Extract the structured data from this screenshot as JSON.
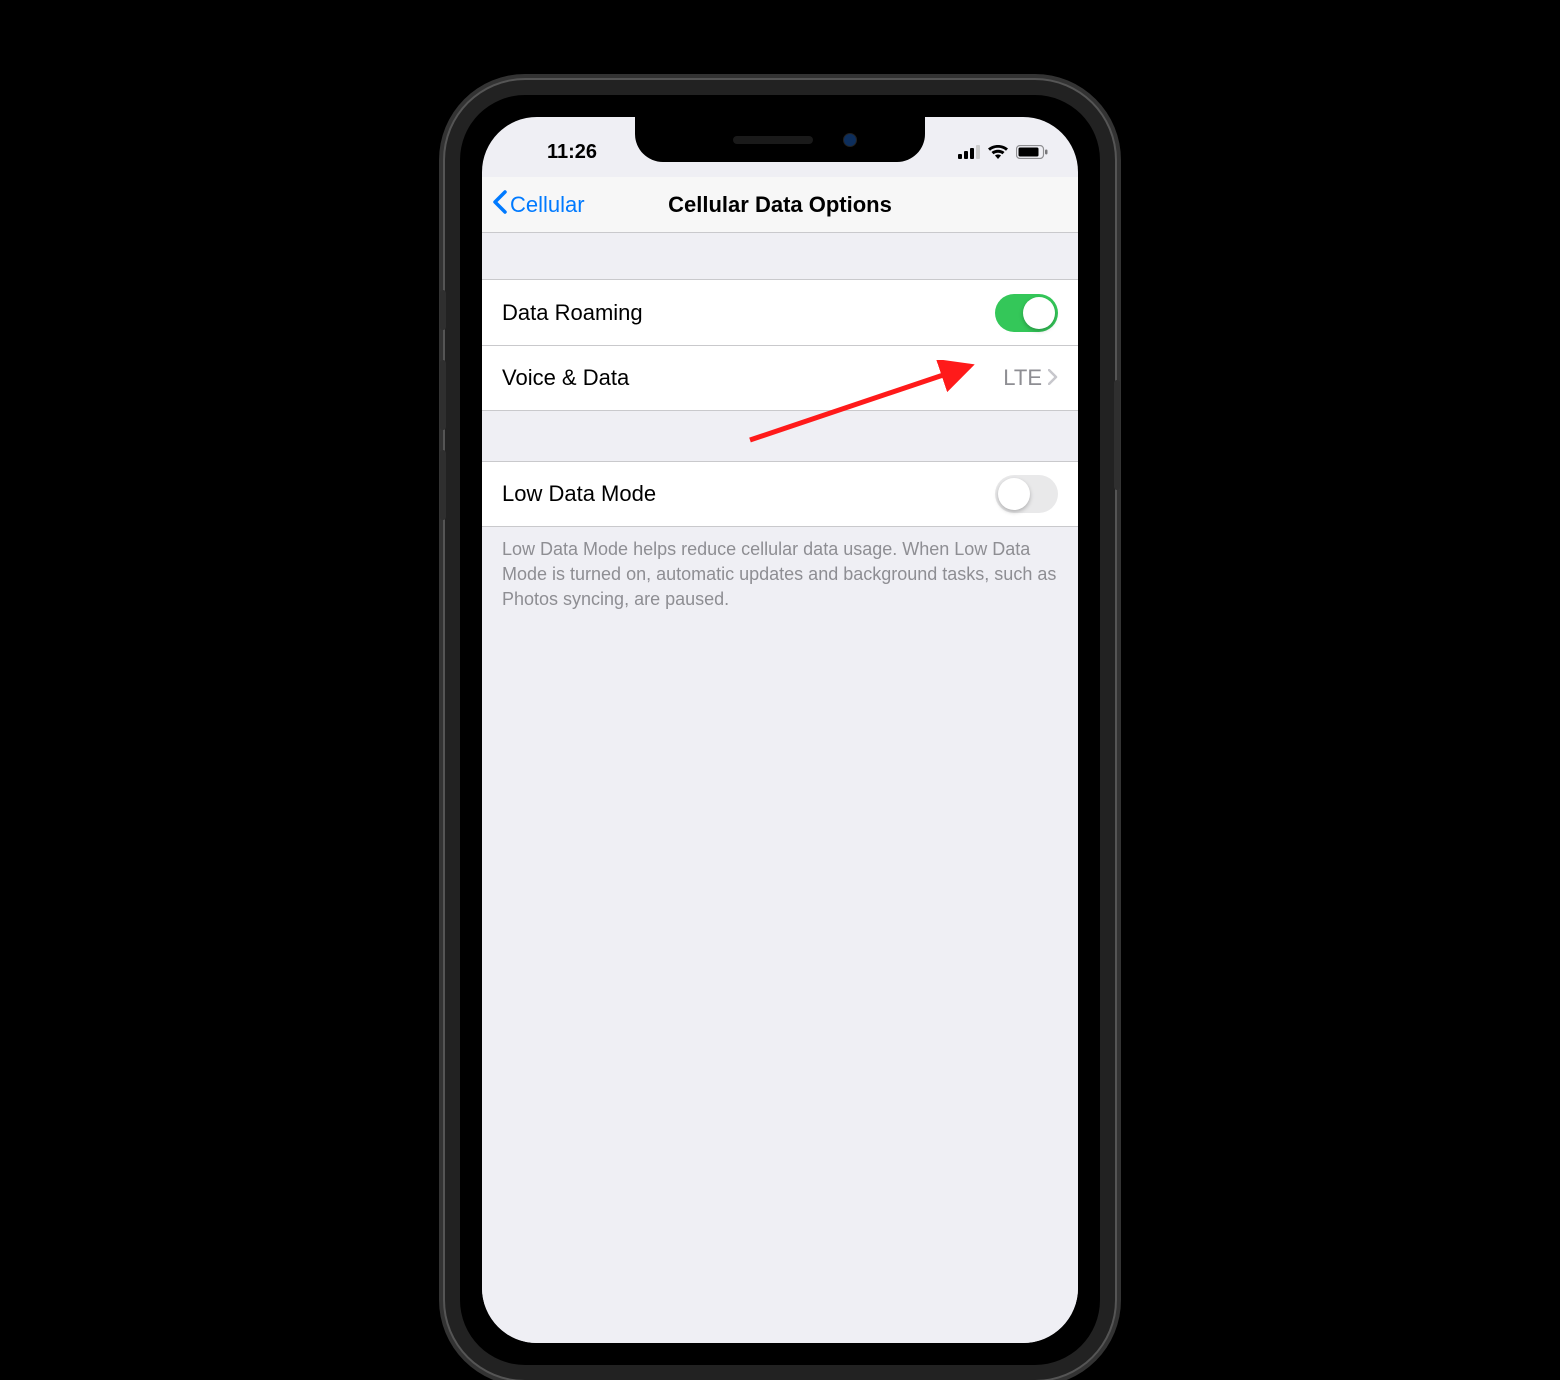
{
  "status_bar": {
    "time": "11:26"
  },
  "nav": {
    "back_label": "Cellular",
    "title": "Cellular Data Options"
  },
  "cells": {
    "data_roaming": {
      "label": "Data Roaming",
      "on": true
    },
    "voice_data": {
      "label": "Voice & Data",
      "value": "LTE"
    },
    "low_data_mode": {
      "label": "Low Data Mode",
      "on": false
    }
  },
  "footer": {
    "low_data_mode_desc": "Low Data Mode helps reduce cellular data usage. When Low Data Mode is turned on, automatic updates and background tasks, such as Photos syncing, are paused."
  },
  "annotation": {
    "arrow_color": "#ff1a1a"
  }
}
